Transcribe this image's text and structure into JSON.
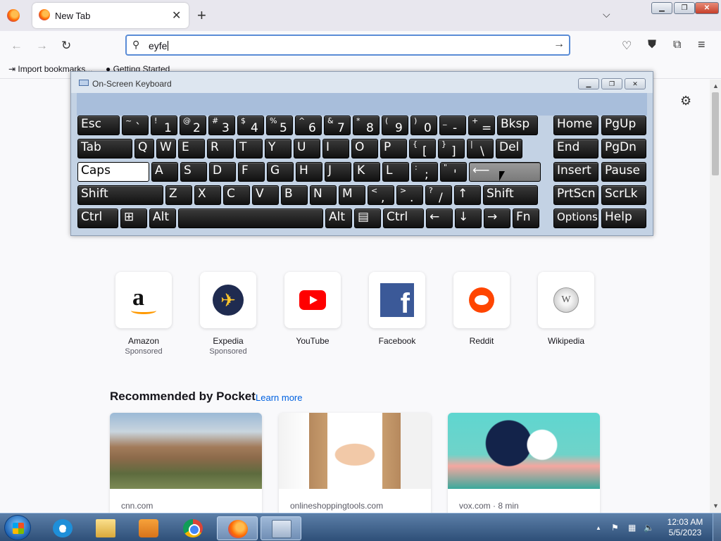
{
  "browser": {
    "tab_title": "New Tab",
    "tab_close": "✕",
    "new_tab": "+",
    "tab_list": "⌵",
    "window_controls": {
      "minimize": "▁",
      "restore": "❐",
      "close": "✕"
    },
    "nav": {
      "back": "←",
      "forward": "→",
      "reload": "↻"
    },
    "url": {
      "value": "eyfe",
      "search_glyph": "⚲",
      "go_glyph": "→"
    },
    "toolbar": {
      "pocket": "♡",
      "shield": "⛊",
      "extensions": "⧉",
      "menu": "≡"
    },
    "bookmarks": [
      {
        "label": "Import bookmarks..."
      },
      {
        "label": "Getting Started"
      }
    ]
  },
  "newtab": {
    "settings_glyph": "⚙",
    "top_sites": [
      {
        "name": "Amazon",
        "sponsored": "Sponsored",
        "icon": "amazon-logo-icon"
      },
      {
        "name": "Expedia",
        "sponsored": "Sponsored",
        "icon": "expedia-logo-icon"
      },
      {
        "name": "YouTube",
        "sponsored": "",
        "icon": "youtube-logo-icon"
      },
      {
        "name": "Facebook",
        "sponsored": "",
        "icon": "facebook-logo-icon"
      },
      {
        "name": "Reddit",
        "sponsored": "",
        "icon": "reddit-logo-icon"
      },
      {
        "name": "Wikipedia",
        "sponsored": "",
        "icon": "wikipedia-logo-icon"
      }
    ],
    "pocket": {
      "title": "Recommended by Pocket",
      "learn_more": "Learn more",
      "cards": [
        {
          "source": "cnn.com"
        },
        {
          "source": "onlineshoppingtools.com"
        },
        {
          "source": "vox.com · 8 min"
        }
      ]
    }
  },
  "osk": {
    "title": "On-Screen Keyboard",
    "controls": {
      "minimize": "▁",
      "restore": "❐",
      "close": "✕"
    },
    "rows": {
      "r1": [
        "Esc",
        "~ `",
        "! 1",
        "@ 2",
        "# 3",
        "$ 4",
        "% 5",
        "^ 6",
        "& 7",
        "* 8",
        "( 9",
        ") 0",
        "_ -",
        "+ =",
        "Bksp",
        "Home",
        "PgUp"
      ],
      "r2": [
        "Tab",
        "Q",
        "W",
        "E",
        "R",
        "T",
        "Y",
        "U",
        "I",
        "O",
        "P",
        "{ [",
        "} ]",
        "| \\",
        "Del",
        "End",
        "PgDn"
      ],
      "r3": [
        "Caps",
        "A",
        "S",
        "D",
        "F",
        "G",
        "H",
        "J",
        "K",
        "L",
        ": ;",
        "\" '",
        "⟵",
        "Insert",
        "Pause"
      ],
      "r4": [
        "Shift",
        "Z",
        "X",
        "C",
        "V",
        "B",
        "N",
        "M",
        "< ,",
        "> .",
        "? /",
        "↑",
        "Shift",
        "PrtScn",
        "ScrLk"
      ],
      "r5": [
        "Ctrl",
        "⊞",
        "Alt",
        "",
        "Alt",
        "▤",
        "Ctrl",
        "←",
        "↓",
        "→",
        "Fn",
        "Options",
        "Help"
      ]
    }
  },
  "taskbar": {
    "clock_time": "12:03 AM",
    "clock_date": "5/5/2023",
    "tray": {
      "up": "▲",
      "flag": "⚑",
      "network": "▦",
      "volume": "🔈"
    }
  }
}
